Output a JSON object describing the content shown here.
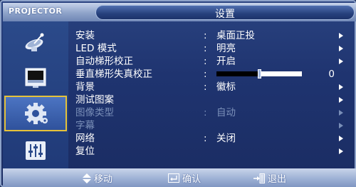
{
  "brand": "PROJECTOR",
  "title": "设置",
  "sidebar": {
    "items": [
      {
        "icon": "satellite-dish-icon",
        "selected": false
      },
      {
        "icon": "picture-icon",
        "selected": false
      },
      {
        "icon": "gear-icon",
        "selected": true
      },
      {
        "icon": "equalizer-icon",
        "selected": false
      }
    ]
  },
  "menu": {
    "items": [
      {
        "label": "安装",
        "value": "桌面正投",
        "enabled": true,
        "arrow": true
      },
      {
        "label": "LED 模式",
        "value": "明亮",
        "enabled": true,
        "arrow": true
      },
      {
        "label": "自动梯形校正",
        "value": "开启",
        "enabled": true,
        "arrow": true
      },
      {
        "label": "垂直梯形失真校正",
        "slider_value": "0",
        "slider_level": 0.5,
        "enabled": true
      },
      {
        "label": "背景",
        "value": "徽标",
        "enabled": true,
        "arrow": true
      },
      {
        "label": "测试图案",
        "enabled": true,
        "arrow": true
      },
      {
        "label": "图像类型",
        "value": "自动",
        "enabled": false,
        "arrow": true
      },
      {
        "label": "字幕",
        "enabled": false,
        "arrow": true
      },
      {
        "label": "网络",
        "value": "关闭",
        "enabled": true,
        "arrow": true
      },
      {
        "label": "复位",
        "enabled": true,
        "arrow": true
      }
    ],
    "colon": ":"
  },
  "footer": {
    "move": "移动",
    "confirm": "确认",
    "exit": "退出"
  },
  "colors": {
    "background": "#1f3470",
    "selected_border": "#e5c23a",
    "disabled_text": "#7a8fb8"
  }
}
